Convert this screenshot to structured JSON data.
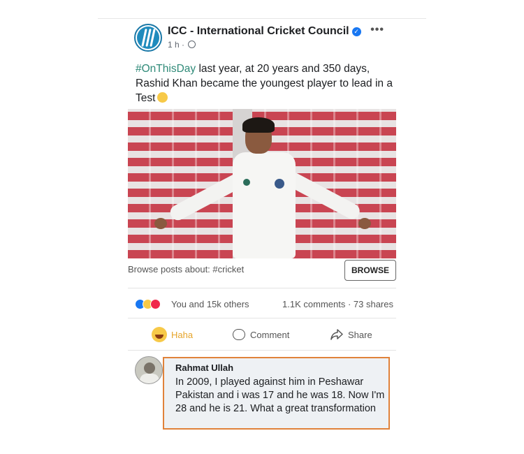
{
  "post": {
    "page_name": "ICC - International Cricket Council",
    "time": "1 h",
    "separator": "·",
    "text_hashtag": "#OnThisDay",
    "text_body": " last year, at 20 years and 350 days, Rashid Khan became the youngest player to lead in a Test",
    "more_label": "•••"
  },
  "browse": {
    "text": "Browse posts about: #cricket",
    "button_label": "BROWSE"
  },
  "engagement": {
    "reactions_text": "You and 15k others",
    "stats_text": "1.1K comments · 73 shares"
  },
  "actions": {
    "haha_label": "Haha",
    "comment_label": "Comment",
    "share_label": "Share"
  },
  "comment": {
    "author": "Rahmat Ullah",
    "text": "In 2009, I played against him in Peshawar Pakistan and i was 17 and he was 18. Now I'm 28 and he is 21. What a great transformation"
  },
  "colors": {
    "hashtag": "#2f8a78",
    "verified": "#1877f2",
    "haha_active": "#e6a42a",
    "comment_highlight_border": "#e0823a"
  },
  "icons": [
    "icc-logo-icon",
    "verified-icon",
    "globe-icon",
    "more-icon",
    "like-reaction-icon",
    "haha-reaction-icon",
    "love-reaction-icon",
    "haha-icon",
    "comment-icon",
    "share-icon"
  ]
}
